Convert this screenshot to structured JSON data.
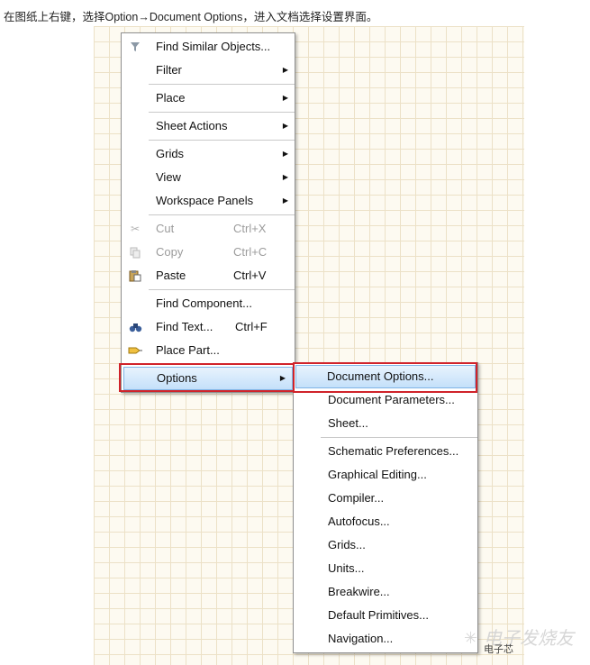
{
  "caption": "在图纸上右键，选择Option→Document Options，进入文档选择设置界面。",
  "context_menu": {
    "groups": [
      [
        {
          "label": "Find Similar Objects...",
          "icon": "filter-icon"
        }
      ],
      [
        {
          "label": "Filter",
          "submenu": true
        }
      ],
      [
        {
          "label": "Place",
          "submenu": true
        }
      ],
      [
        {
          "label": "Sheet Actions",
          "submenu": true
        }
      ],
      [
        {
          "label": "Grids",
          "submenu": true
        },
        {
          "label": "View",
          "submenu": true
        },
        {
          "label": "Workspace Panels",
          "submenu": true
        }
      ],
      [
        {
          "label": "Cut",
          "shortcut": "Ctrl+X",
          "disabled": true,
          "icon": "scissors-icon"
        },
        {
          "label": "Copy",
          "shortcut": "Ctrl+C",
          "disabled": true,
          "icon": "copy-icon"
        },
        {
          "label": "Paste",
          "shortcut": "Ctrl+V",
          "icon": "paste-icon"
        }
      ],
      [
        {
          "label": "Find Component..."
        },
        {
          "label": "Find Text...",
          "shortcut": "Ctrl+F",
          "icon": "binoculars-icon"
        },
        {
          "label": "Place Part...",
          "icon": "place-part-icon"
        }
      ],
      [
        {
          "label": "Options",
          "submenu": true,
          "highlighted": true
        }
      ]
    ]
  },
  "options_submenu": {
    "groups": [
      [
        {
          "label": "Document Options...",
          "highlighted": true
        },
        {
          "label": "Document Parameters..."
        },
        {
          "label": "Sheet..."
        }
      ],
      [
        {
          "label": "Schematic Preferences..."
        },
        {
          "label": "Graphical Editing..."
        },
        {
          "label": "Compiler..."
        },
        {
          "label": "Autofocus..."
        },
        {
          "label": "Grids..."
        },
        {
          "label": "Units..."
        },
        {
          "label": "Breakwire..."
        },
        {
          "label": "Default Primitives..."
        },
        {
          "label": "Navigation..."
        }
      ]
    ]
  },
  "watermark": {
    "text": "电子发烧友",
    "small": "电子芯"
  },
  "colors": {
    "highlight_border": "#7fb4e6",
    "annotation_red": "#d0232a",
    "grid": "#ece1c7"
  }
}
